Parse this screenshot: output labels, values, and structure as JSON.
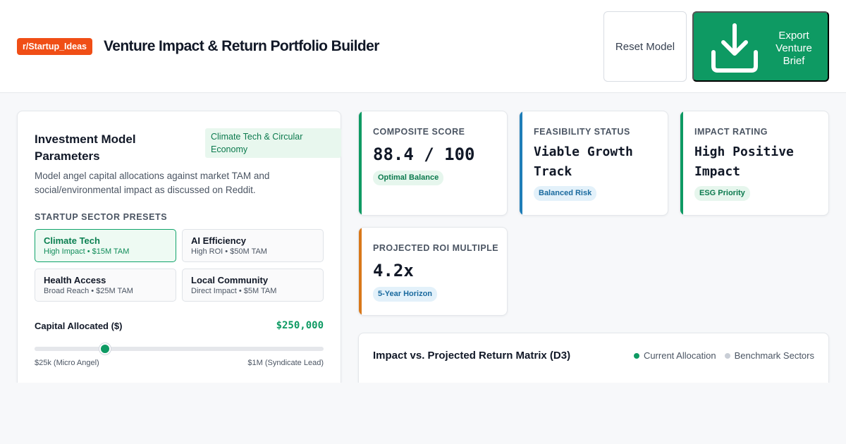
{
  "header": {
    "tag": "r/Startup_Ideas",
    "title": "Venture Impact & Return Portfolio Builder",
    "reset_label": "Reset Model",
    "export_label": "Export Venture Brief",
    "export_icon": "download-icon"
  },
  "params": {
    "title": "Investment Model Parameters",
    "badge": "Climate Tech & Circular Economy",
    "description": "Model angel capital allocations against market TAM and social/environmental impact as discussed on Reddit.",
    "presets_label": "STARTUP SECTOR PRESETS",
    "presets": [
      {
        "name": "Climate Tech",
        "detail": "High Impact • $15M TAM",
        "active": true
      },
      {
        "name": "AI Efficiency",
        "detail": "High ROI • $50M TAM",
        "active": false
      },
      {
        "name": "Health Access",
        "detail": "Broad Reach • $25M TAM",
        "active": false
      },
      {
        "name": "Local Community",
        "detail": "Direct Impact • $5M TAM",
        "active": false
      }
    ],
    "capital": {
      "label": "Capital Allocated ($)",
      "value": "$250,000",
      "slider_fraction": 0.243,
      "min_label": "$25k (Micro Angel)",
      "max_label": "$1M (Syndicate Lead)"
    }
  },
  "metrics": [
    {
      "label": "COMPOSITE SCORE",
      "value": "88.4 / 100",
      "badge": "Optimal Balance",
      "color": "#0e9a63",
      "badge_bg": "#e6f6ed",
      "badge_fg": "#0c7a4e"
    },
    {
      "label": "FEASIBILITY STATUS",
      "value": "Viable Growth Track",
      "badge": "Balanced Risk",
      "color": "#1e7db8",
      "badge_bg": "#e3f1fa",
      "badge_fg": "#1a6a9e"
    },
    {
      "label": "IMPACT RATING",
      "value": "High Positive Impact",
      "badge": "ESG Priority",
      "color": "#0e9a63",
      "badge_bg": "#e6f6ed",
      "badge_fg": "#0c7a4e"
    },
    {
      "label": "PROJECTED ROI MULTIPLE",
      "value": "4.2x",
      "badge": "5-Year Horizon",
      "color": "#d9781a",
      "badge_bg": "#e3f1fa",
      "badge_fg": "#1a6a9e"
    }
  ],
  "matrix": {
    "title": "Impact vs. Projected Return Matrix (D3)",
    "legend": [
      {
        "label": "Current Allocation",
        "color": "#0e9a63"
      },
      {
        "label": "Benchmark Sectors",
        "color": "#c9ced6"
      }
    ]
  }
}
